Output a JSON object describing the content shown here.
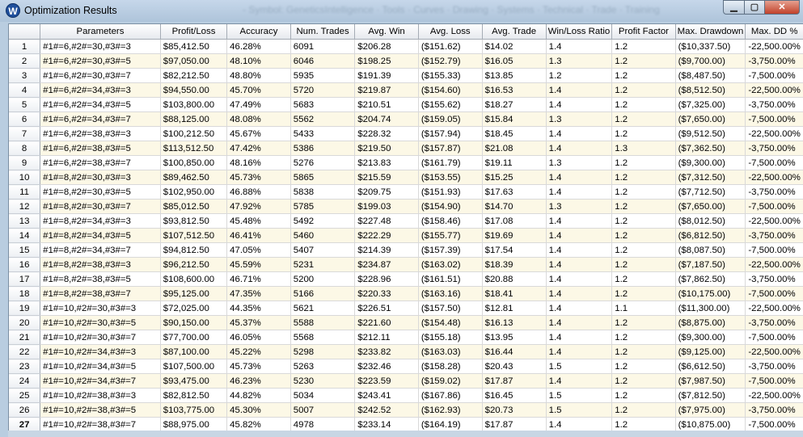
{
  "window": {
    "title": "Optimization Results",
    "ghost_title": "- Symbol: GeneticsIntelligence · Tools · Curves · Drawing · Systems · Technical · Trade · Training",
    "min_glyph": "▁",
    "max_glyph": "▢",
    "close_glyph": "✕",
    "app_icon_glyph": "W",
    "icon": "app-w-icon"
  },
  "table": {
    "columns": [
      "Parameters",
      "Profit/Loss",
      "Accuracy",
      "Num. Trades",
      "Avg. Win",
      "Avg. Loss",
      "Avg. Trade",
      "Win/Loss Ratio",
      "Profit Factor",
      "Max. Drawdown",
      "Max. DD %"
    ],
    "selected_row": 27,
    "rows": [
      [
        "1",
        "#1#=6,#2#=30,#3#=3",
        "$85,412.50",
        "46.28%",
        "6091",
        "$206.28",
        "($151.62)",
        "$14.02",
        "1.4",
        "1.2",
        "($10,337.50)",
        "-22,500.00%"
      ],
      [
        "2",
        "#1#=6,#2#=30,#3#=5",
        "$97,050.00",
        "48.10%",
        "6046",
        "$198.25",
        "($152.79)",
        "$16.05",
        "1.3",
        "1.2",
        "($9,700.00)",
        "-3,750.00%"
      ],
      [
        "3",
        "#1#=6,#2#=30,#3#=7",
        "$82,212.50",
        "48.80%",
        "5935",
        "$191.39",
        "($155.33)",
        "$13.85",
        "1.2",
        "1.2",
        "($8,487.50)",
        "-7,500.00%"
      ],
      [
        "4",
        "#1#=6,#2#=34,#3#=3",
        "$94,550.00",
        "45.70%",
        "5720",
        "$219.87",
        "($154.60)",
        "$16.53",
        "1.4",
        "1.2",
        "($8,512.50)",
        "-22,500.00%"
      ],
      [
        "5",
        "#1#=6,#2#=34,#3#=5",
        "$103,800.00",
        "47.49%",
        "5683",
        "$210.51",
        "($155.62)",
        "$18.27",
        "1.4",
        "1.2",
        "($7,325.00)",
        "-3,750.00%"
      ],
      [
        "6",
        "#1#=6,#2#=34,#3#=7",
        "$88,125.00",
        "48.08%",
        "5562",
        "$204.74",
        "($159.05)",
        "$15.84",
        "1.3",
        "1.2",
        "($7,650.00)",
        "-7,500.00%"
      ],
      [
        "7",
        "#1#=6,#2#=38,#3#=3",
        "$100,212.50",
        "45.67%",
        "5433",
        "$228.32",
        "($157.94)",
        "$18.45",
        "1.4",
        "1.2",
        "($9,512.50)",
        "-22,500.00%"
      ],
      [
        "8",
        "#1#=6,#2#=38,#3#=5",
        "$113,512.50",
        "47.42%",
        "5386",
        "$219.50",
        "($157.87)",
        "$21.08",
        "1.4",
        "1.3",
        "($7,362.50)",
        "-3,750.00%"
      ],
      [
        "9",
        "#1#=6,#2#=38,#3#=7",
        "$100,850.00",
        "48.16%",
        "5276",
        "$213.83",
        "($161.79)",
        "$19.11",
        "1.3",
        "1.2",
        "($9,300.00)",
        "-7,500.00%"
      ],
      [
        "10",
        "#1#=8,#2#=30,#3#=3",
        "$89,462.50",
        "45.73%",
        "5865",
        "$215.59",
        "($153.55)",
        "$15.25",
        "1.4",
        "1.2",
        "($7,312.50)",
        "-22,500.00%"
      ],
      [
        "11",
        "#1#=8,#2#=30,#3#=5",
        "$102,950.00",
        "46.88%",
        "5838",
        "$209.75",
        "($151.93)",
        "$17.63",
        "1.4",
        "1.2",
        "($7,712.50)",
        "-3,750.00%"
      ],
      [
        "12",
        "#1#=8,#2#=30,#3#=7",
        "$85,012.50",
        "47.92%",
        "5785",
        "$199.03",
        "($154.90)",
        "$14.70",
        "1.3",
        "1.2",
        "($7,650.00)",
        "-7,500.00%"
      ],
      [
        "13",
        "#1#=8,#2#=34,#3#=3",
        "$93,812.50",
        "45.48%",
        "5492",
        "$227.48",
        "($158.46)",
        "$17.08",
        "1.4",
        "1.2",
        "($8,012.50)",
        "-22,500.00%"
      ],
      [
        "14",
        "#1#=8,#2#=34,#3#=5",
        "$107,512.50",
        "46.41%",
        "5460",
        "$222.29",
        "($155.77)",
        "$19.69",
        "1.4",
        "1.2",
        "($6,812.50)",
        "-3,750.00%"
      ],
      [
        "15",
        "#1#=8,#2#=34,#3#=7",
        "$94,812.50",
        "47.05%",
        "5407",
        "$214.39",
        "($157.39)",
        "$17.54",
        "1.4",
        "1.2",
        "($8,087.50)",
        "-7,500.00%"
      ],
      [
        "16",
        "#1#=8,#2#=38,#3#=3",
        "$96,212.50",
        "45.59%",
        "5231",
        "$234.87",
        "($163.02)",
        "$18.39",
        "1.4",
        "1.2",
        "($7,187.50)",
        "-22,500.00%"
      ],
      [
        "17",
        "#1#=8,#2#=38,#3#=5",
        "$108,600.00",
        "46.71%",
        "5200",
        "$228.96",
        "($161.51)",
        "$20.88",
        "1.4",
        "1.2",
        "($7,862.50)",
        "-3,750.00%"
      ],
      [
        "18",
        "#1#=8,#2#=38,#3#=7",
        "$95,125.00",
        "47.35%",
        "5166",
        "$220.33",
        "($163.16)",
        "$18.41",
        "1.4",
        "1.2",
        "($10,175.00)",
        "-7,500.00%"
      ],
      [
        "19",
        "#1#=10,#2#=30,#3#=3",
        "$72,025.00",
        "44.35%",
        "5621",
        "$226.51",
        "($157.50)",
        "$12.81",
        "1.4",
        "1.1",
        "($11,300.00)",
        "-22,500.00%"
      ],
      [
        "20",
        "#1#=10,#2#=30,#3#=5",
        "$90,150.00",
        "45.37%",
        "5588",
        "$221.60",
        "($154.48)",
        "$16.13",
        "1.4",
        "1.2",
        "($8,875.00)",
        "-3,750.00%"
      ],
      [
        "21",
        "#1#=10,#2#=30,#3#=7",
        "$77,700.00",
        "46.05%",
        "5568",
        "$212.11",
        "($155.18)",
        "$13.95",
        "1.4",
        "1.2",
        "($9,300.00)",
        "-7,500.00%"
      ],
      [
        "22",
        "#1#=10,#2#=34,#3#=3",
        "$87,100.00",
        "45.22%",
        "5298",
        "$233.82",
        "($163.03)",
        "$16.44",
        "1.4",
        "1.2",
        "($9,125.00)",
        "-22,500.00%"
      ],
      [
        "23",
        "#1#=10,#2#=34,#3#=5",
        "$107,500.00",
        "45.73%",
        "5263",
        "$232.46",
        "($158.28)",
        "$20.43",
        "1.5",
        "1.2",
        "($6,612.50)",
        "-3,750.00%"
      ],
      [
        "24",
        "#1#=10,#2#=34,#3#=7",
        "$93,475.00",
        "46.23%",
        "5230",
        "$223.59",
        "($159.02)",
        "$17.87",
        "1.4",
        "1.2",
        "($7,987.50)",
        "-7,500.00%"
      ],
      [
        "25",
        "#1#=10,#2#=38,#3#=3",
        "$82,812.50",
        "44.82%",
        "5034",
        "$243.41",
        "($167.86)",
        "$16.45",
        "1.5",
        "1.2",
        "($7,812.50)",
        "-22,500.00%"
      ],
      [
        "26",
        "#1#=10,#2#=38,#3#=5",
        "$103,775.00",
        "45.30%",
        "5007",
        "$242.52",
        "($162.93)",
        "$20.73",
        "1.5",
        "1.2",
        "($7,975.00)",
        "-3,750.00%"
      ],
      [
        "27",
        "#1#=10,#2#=38,#3#=7",
        "$88,975.00",
        "45.82%",
        "4978",
        "$233.14",
        "($164.19)",
        "$17.87",
        "1.4",
        "1.2",
        "($10,875.00)",
        "-7,500.00%"
      ]
    ]
  }
}
